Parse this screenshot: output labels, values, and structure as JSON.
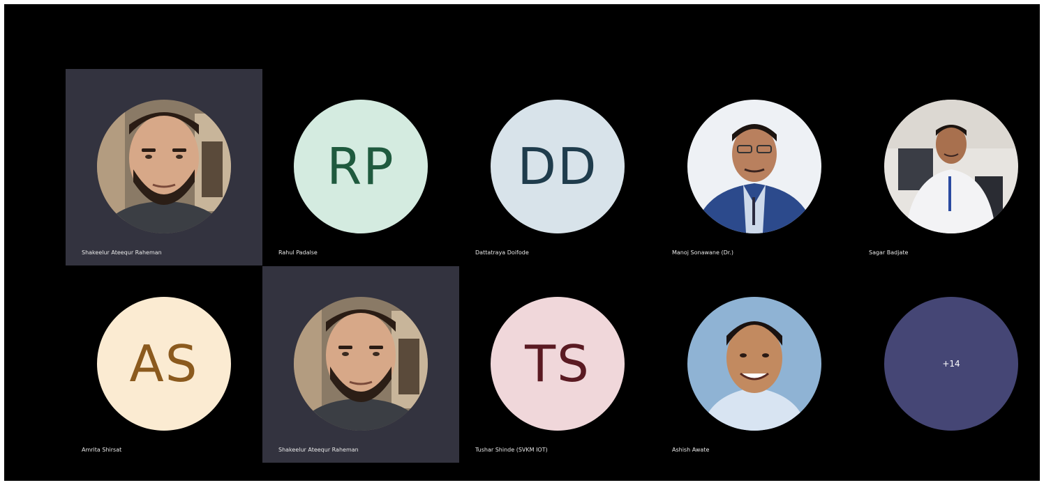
{
  "participants": [
    {
      "name": "Shakeelur Ateequr Raheman",
      "initials": "",
      "has_photo": true,
      "photo_style": "bearded-man",
      "speaking": true
    },
    {
      "name": "Rahul Padalse",
      "initials": "RP",
      "has_photo": false,
      "bg": "#d4ebe0",
      "fg": "#1f5a3e",
      "speaking": false
    },
    {
      "name": "Dattatraya Doifode",
      "initials": "DD",
      "has_photo": false,
      "bg": "#d8e3ea",
      "fg": "#1f3c4c",
      "speaking": false
    },
    {
      "name": "Manoj Sonawane (Dr.)",
      "initials": "",
      "has_photo": true,
      "photo_style": "man-blue-blazer",
      "speaking": false
    },
    {
      "name": "Sagar Badjate",
      "initials": "",
      "has_photo": true,
      "photo_style": "man-white-shirt-office",
      "speaking": false
    },
    {
      "name": "Amrita Shirsat",
      "initials": "AS",
      "has_photo": false,
      "bg": "#fbebd2",
      "fg": "#8b5a1e",
      "speaking": false
    },
    {
      "name": "Shakeelur Ateequr Raheman",
      "initials": "",
      "has_photo": true,
      "photo_style": "bearded-man",
      "speaking": true
    },
    {
      "name": "Tushar Shinde (SVKM IOT)",
      "initials": "TS",
      "has_photo": false,
      "bg": "#f0d7da",
      "fg": "#5a1a22",
      "speaking": false
    },
    {
      "name": "Ashish Awate",
      "initials": "",
      "has_photo": true,
      "photo_style": "smiling-man-blue-bg",
      "speaking": false
    }
  ],
  "overflow": {
    "label": "+14",
    "bg": "#454675",
    "fg": "#ffffff"
  },
  "colors": {
    "background": "#000000",
    "speaking_tile": "#33333f",
    "name_text": "#e8e8e8"
  }
}
